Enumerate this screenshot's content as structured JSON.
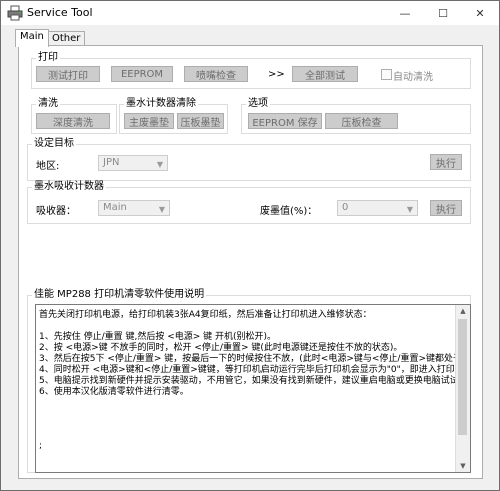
{
  "window": {
    "title": "Service Tool",
    "minimize_glyph": "—",
    "maximize_glyph": "☐",
    "close_glyph": "✕"
  },
  "tabs": [
    {
      "label": "Main"
    },
    {
      "label": "Other"
    }
  ],
  "print_group": {
    "label": "打印",
    "btn_test": "测试打印",
    "btn_eeprom": "EEPROM",
    "btn_nozzle": "喷嘴检查",
    "arrows": ">>",
    "btn_all": "全部测试",
    "auto_clean": "自动清洗"
  },
  "clean_group": {
    "label": "清洗",
    "btn_deep": "深度清洗"
  },
  "ink_counter_group": {
    "label": "墨水计数器清除",
    "btn_main": "主废墨垫",
    "btn_platen": "压板墨垫"
  },
  "options_group": {
    "label": "选项",
    "btn_save": "EEPROM 保存",
    "btn_platen_check": "压板检查"
  },
  "target_group": {
    "label": "设定目标",
    "region_label": "地区:",
    "region_value": "JPN",
    "btn_exec": "执行"
  },
  "absorber_group": {
    "label": "墨水吸收计数器",
    "absorber_label": "吸收器：",
    "absorber_value": "Main",
    "waste_label": "废墨值(%)：",
    "waste_value": "0",
    "btn_exec": "执行"
  },
  "instructions": {
    "title": "佳能 MP288 打印机清零软件使用说明",
    "lines": [
      "首先关闭打印机电源，给打印机装3张A4复印纸，然后准备让打印机进入维修状态：",
      "",
      "1、先按住 停止/重置 键,然后按 <电源> 键   开机(别松开)。",
      "2、按 <电源>键 不放手的同时，松开 <停止/重置> 键(此时电源键还是按住不放的状态)。",
      "3、然后在按5下 <停止/重置> 键，按最后一下的时候按住不放，(此时<电源>键与<停止/重置>键都处于按",
      "4、同时松开 <电源>键和<停止/重置>键键，等打印机启动运行完毕后打印机会显示为\"0\"，即进入打印机",
      "5、电脑提示找到新硬件并提示安装驱动，不用管它，如果没有找到新硬件，建议重启电脑或更换电脑试试",
      "6、使用本汉化版清零软件进行清零。",
      "",
      "",
      ""
    ],
    "caret": ";"
  },
  "icons": {
    "app": "printer-icon"
  }
}
